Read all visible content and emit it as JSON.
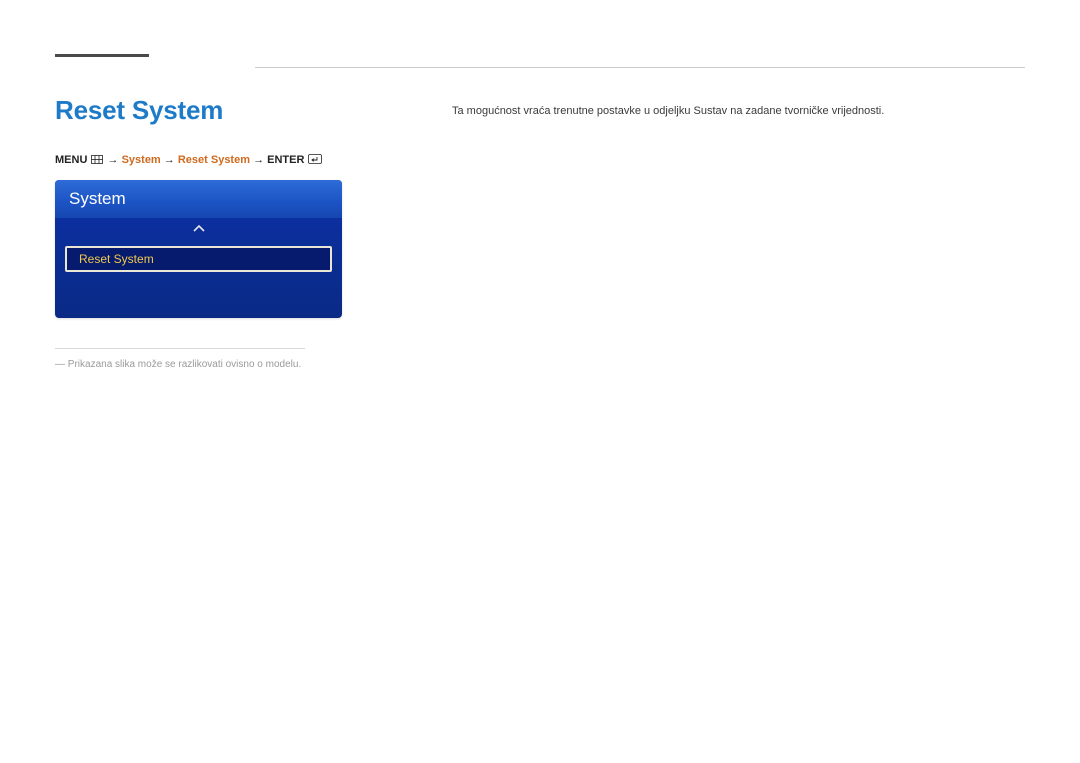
{
  "title": "Reset System",
  "breadcrumb": {
    "menu": "MENU",
    "system": "System",
    "reset_system": "Reset System",
    "enter": "ENTER",
    "arrow": "→"
  },
  "osd": {
    "header": "System",
    "item": "Reset System"
  },
  "footnote": {
    "dash": "―",
    "text": "Prikazana slika može se razlikovati ovisno o modelu."
  },
  "body": {
    "text": "Ta mogućnost vraća trenutne postavke u odjeljku Sustav na zadane tvorničke vrijednosti."
  }
}
